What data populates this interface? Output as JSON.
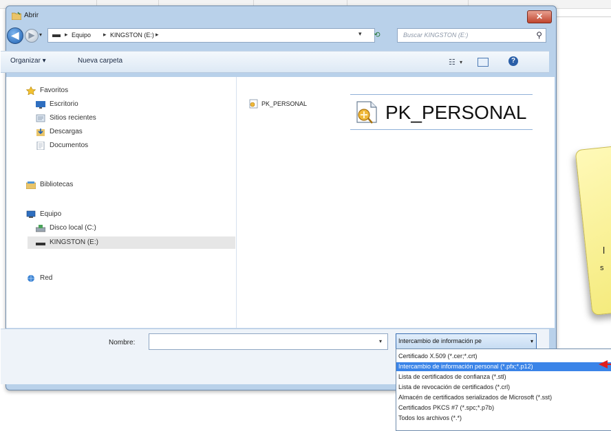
{
  "window": {
    "title": "Abrir",
    "close_glyph": "✕"
  },
  "navigation": {
    "back_glyph": "◀",
    "forward_glyph": "▶",
    "address_parts": [
      "Equipo",
      "KINGSTON (E:)"
    ],
    "search_placeholder": "Buscar KINGSTON (E:)"
  },
  "toolbar": {
    "organize_label": "Organizar ▾",
    "new_folder_label": "Nueva carpeta"
  },
  "sidebar": {
    "favorites": {
      "label": "Favoritos",
      "icon": "star-icon"
    },
    "favorite_items": [
      {
        "label": "Escritorio",
        "icon": "desktop-icon"
      },
      {
        "label": "Sitios recientes",
        "icon": "recent-places-icon"
      },
      {
        "label": "Descargas",
        "icon": "downloads-icon"
      },
      {
        "label": "Documentos",
        "icon": "documents-icon"
      }
    ],
    "libraries": {
      "label": "Bibliotecas",
      "icon": "libraries-icon"
    },
    "computer": {
      "label": "Equipo",
      "icon": "computer-icon"
    },
    "computer_items": [
      {
        "label": "Disco local (C:)",
        "icon": "drive-icon"
      },
      {
        "label": "KINGSTON (E:)",
        "icon": "usb-drive-icon",
        "selected": true
      }
    ],
    "network": {
      "label": "Red",
      "icon": "network-icon"
    }
  },
  "files": [
    {
      "name": "PK_PERSONAL",
      "icon": "certificate-file-icon"
    }
  ],
  "zoom_callout": {
    "text": "PK_PERSONAL"
  },
  "bottom": {
    "name_label": "Nombre:",
    "name_value": "",
    "filetype_selected": "Intercambio de información pe"
  },
  "filetype_options": [
    {
      "label": "Certificado X.509 (*.cer;*.crt)",
      "selected": false
    },
    {
      "label": "Intercambio de información personal (*.pfx;*.p12)",
      "selected": true
    },
    {
      "label": "Lista de certificados de confianza (*.stl)",
      "selected": false
    },
    {
      "label": "Lista de revocación de certificados (*.crl)",
      "selected": false
    },
    {
      "label": "Almacén de certificados serializados de Microsoft (*.sst)",
      "selected": false
    },
    {
      "label": "Certificados PKCS #7 (*.spc;*.p7b)",
      "selected": false
    },
    {
      "label": "Todos los archivos (*.*)",
      "selected": false
    }
  ],
  "note": {
    "partial_line_1": "l",
    "partial_line_2": "s"
  },
  "colors": {
    "window_frame": "#b9d1ea",
    "selection_blue": "#3a84e8",
    "pointer_red": "#e01d1d",
    "note_yellow": "#f4ea7a"
  }
}
